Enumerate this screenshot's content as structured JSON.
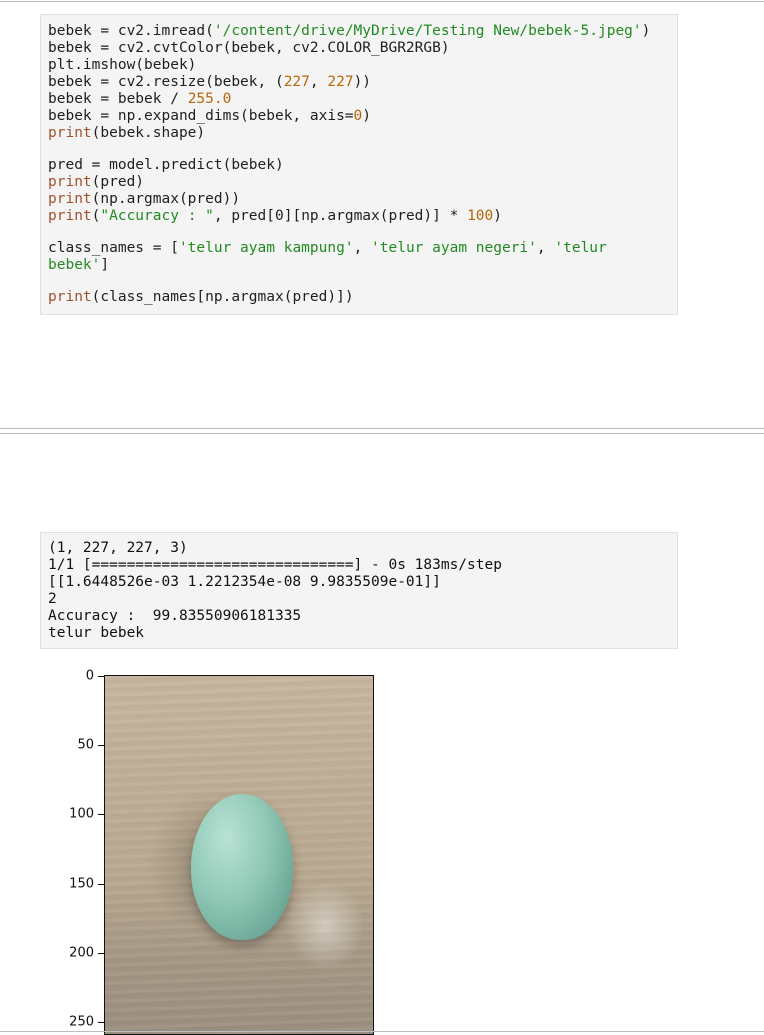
{
  "code_cell": {
    "lines": [
      [
        [
          "",
          "bebek = cv2.imread("
        ],
        [
          "str",
          "'/content/drive/MyDrive/Testing New/bebek-5.jpeg'"
        ],
        [
          "",
          ")"
        ]
      ],
      [
        [
          "",
          "bebek = cv2.cvtColor(bebek, cv2.COLOR_BGR2RGB)"
        ]
      ],
      [
        [
          "",
          "plt.imshow(bebek)"
        ]
      ],
      [
        [
          "",
          "bebek = cv2.resize(bebek, ("
        ],
        [
          "num",
          "227"
        ],
        [
          "",
          ", "
        ],
        [
          "num",
          "227"
        ],
        [
          "",
          "))"
        ]
      ],
      [
        [
          "",
          "bebek = bebek / "
        ],
        [
          "num",
          "255.0"
        ]
      ],
      [
        [
          "",
          "bebek = np.expand_dims(bebek, axis="
        ],
        [
          "num",
          "0"
        ],
        [
          "",
          ")"
        ]
      ],
      [
        [
          "kw",
          "print"
        ],
        [
          "",
          "(bebek.shape)"
        ]
      ],
      [],
      [
        [
          "",
          "pred = model.predict(bebek)"
        ]
      ],
      [
        [
          "kw",
          "print"
        ],
        [
          "",
          "(pred)"
        ]
      ],
      [
        [
          "kw",
          "print"
        ],
        [
          "",
          "(np.argmax(pred))"
        ]
      ],
      [
        [
          "kw",
          "print"
        ],
        [
          "",
          "("
        ],
        [
          "str",
          "\"Accuracy : \""
        ],
        [
          "",
          ", pred[0][np.argmax(pred)] * "
        ],
        [
          "num",
          "100"
        ],
        [
          "",
          ")"
        ]
      ],
      [],
      [
        [
          "",
          "class_names = ["
        ],
        [
          "str",
          "'telur ayam kampung'"
        ],
        [
          "",
          ", "
        ],
        [
          "str",
          "'telur ayam negeri'"
        ],
        [
          "",
          ", "
        ],
        [
          "str",
          "'telur"
        ]
      ],
      [
        [
          "str",
          "bebek'"
        ],
        [
          "",
          "]"
        ]
      ],
      [],
      [
        [
          "kw",
          "print"
        ],
        [
          "",
          "(class_names[np.argmax(pred)])"
        ]
      ]
    ]
  },
  "output_cell": {
    "lines": [
      "(1, 227, 227, 3)",
      "1/1 [==============================] - 0s 183ms/step",
      "[[1.6448526e-03 1.2212354e-08 9.9835509e-01]]",
      "2",
      "Accuracy :  99.83550906181335",
      "telur bebek"
    ]
  },
  "plot": {
    "y_ticks": [
      "0",
      "50",
      "100",
      "150",
      "200",
      "250"
    ],
    "image_subject": "green duck egg on wooden table"
  }
}
